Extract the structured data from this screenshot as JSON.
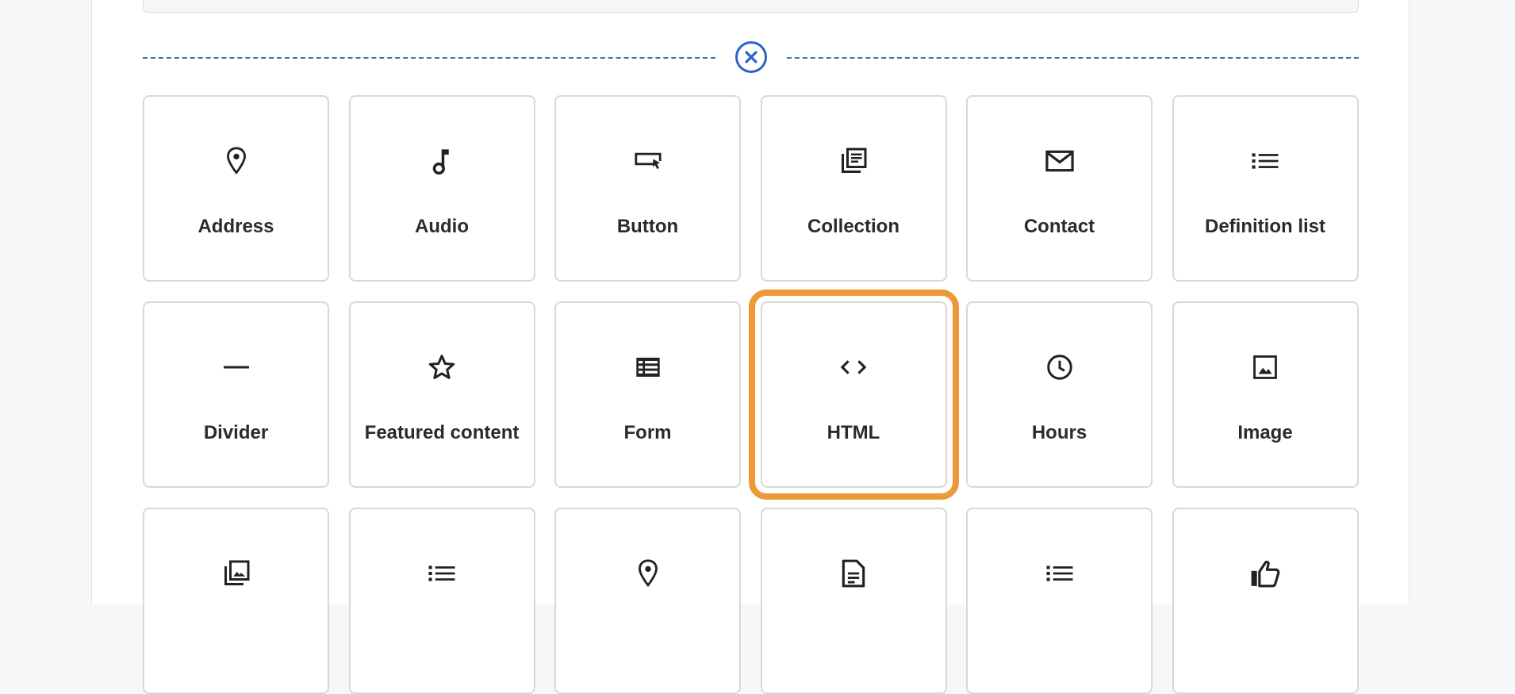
{
  "colors": {
    "accent": "#2a64c8",
    "highlight": "#ee9938",
    "tile_border": "#d8d8d8"
  },
  "close_button": {
    "icon": "close-icon"
  },
  "blocks": [
    {
      "label": "Address",
      "icon": "map-pin-icon"
    },
    {
      "label": "Audio",
      "icon": "music-note-icon"
    },
    {
      "label": "Button",
      "icon": "button-click-icon"
    },
    {
      "label": "Collection",
      "icon": "collection-icon"
    },
    {
      "label": "Contact",
      "icon": "mail-icon"
    },
    {
      "label": "Definition list",
      "icon": "list-icon"
    },
    {
      "label": "Divider",
      "icon": "horizontal-line-icon"
    },
    {
      "label": "Featured content",
      "icon": "star-icon"
    },
    {
      "label": "Form",
      "icon": "form-icon"
    },
    {
      "label": "HTML",
      "icon": "code-icon",
      "highlighted": true
    },
    {
      "label": "Hours",
      "icon": "clock-icon"
    },
    {
      "label": "Image",
      "icon": "image-icon"
    },
    {
      "label": "",
      "icon": "gallery-icon"
    },
    {
      "label": "",
      "icon": "list-icon"
    },
    {
      "label": "",
      "icon": "map-pin-icon"
    },
    {
      "label": "",
      "icon": "document-icon"
    },
    {
      "label": "",
      "icon": "list-icon"
    },
    {
      "label": "",
      "icon": "thumbs-up-icon"
    }
  ]
}
